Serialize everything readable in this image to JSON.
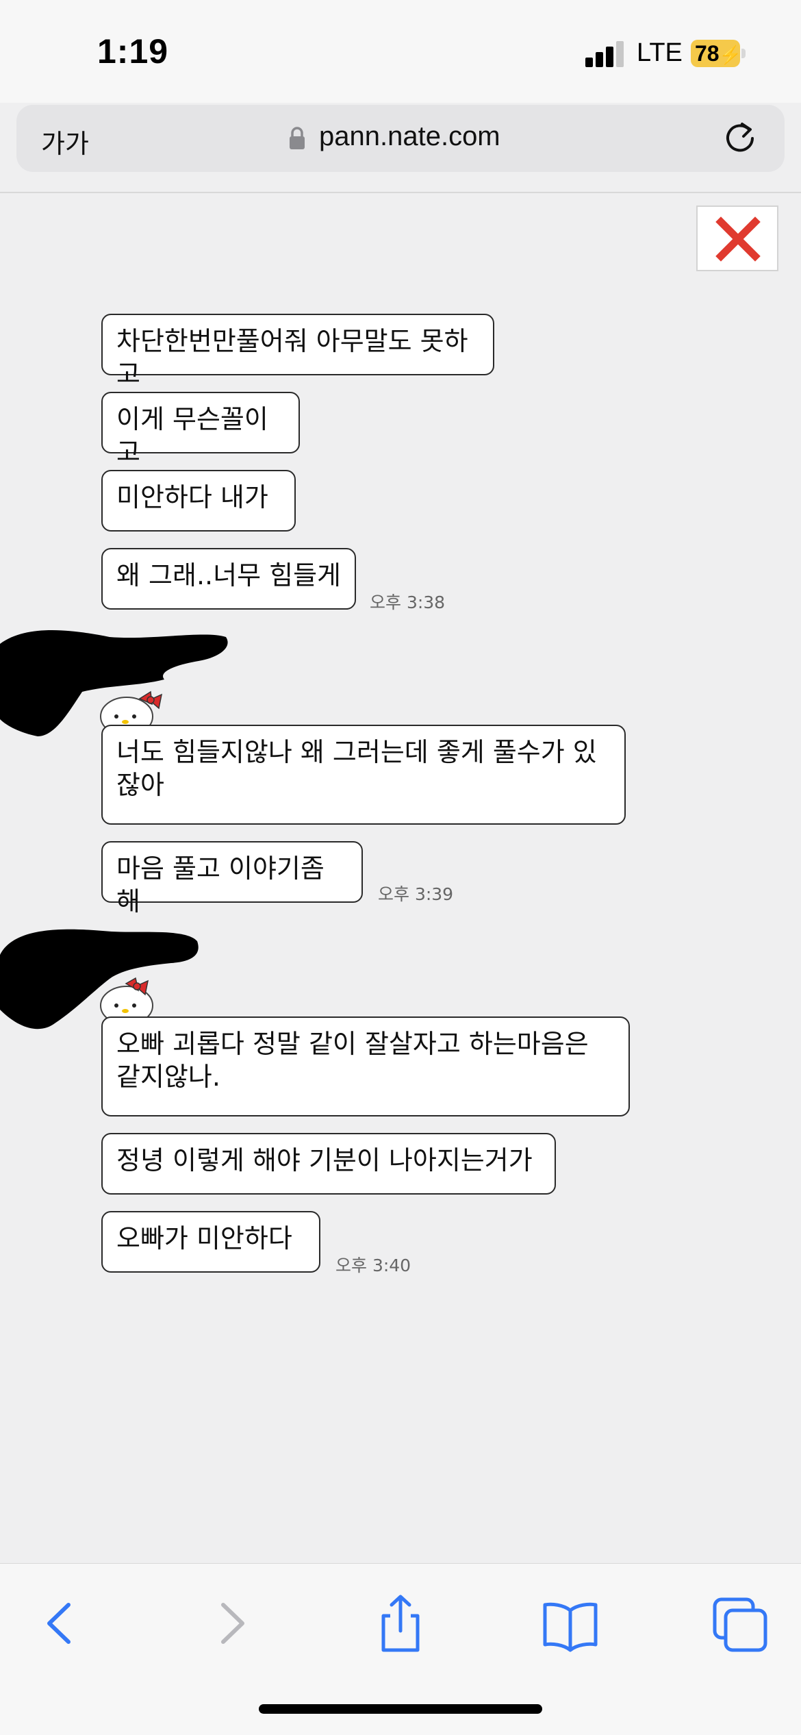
{
  "status_bar": {
    "time": "1:19",
    "carrier": "LTE",
    "battery": "78"
  },
  "browser": {
    "text_size_label": "가가",
    "url": "pann.nate.com"
  },
  "messages": [
    {
      "text": "차단한번만풀어줘 아무말도 못하고"
    },
    {
      "text": "이게 무슨꼴이고"
    },
    {
      "text": "미안하다 내가"
    },
    {
      "text": "왜 그래..너무 힘들게",
      "time": "오후 3:38"
    },
    {
      "text": "너도 힘들지않나 왜 그러는데 좋게 풀수가 있잖아"
    },
    {
      "text": "마음 풀고 이야기좀 해",
      "time": "오후 3:39"
    },
    {
      "text": "오빠 괴롭다 정말 같이 잘살자고 하는마음은 같지않나."
    },
    {
      "text": "정녕 이렇게 해야 기분이 나아지는거가"
    },
    {
      "text": "오빠가 미안하다",
      "time": "오후 3:40"
    }
  ],
  "colors": {
    "accent": "#3478f6",
    "close_red": "#e03a2f",
    "battery_yellow": "#f5c94a"
  },
  "icons": [
    "lock-icon",
    "reload-icon",
    "close-icon",
    "back-icon",
    "forward-icon",
    "share-icon",
    "bookmarks-icon",
    "tabs-icon"
  ]
}
